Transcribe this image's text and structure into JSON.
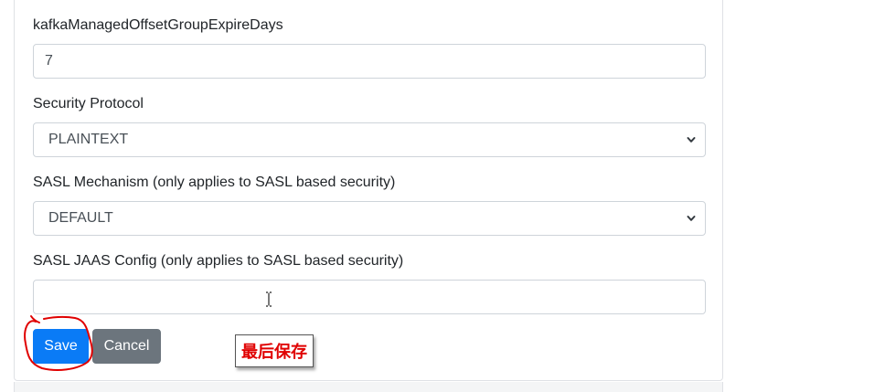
{
  "form": {
    "expire_days": {
      "label": "kafkaManagedOffsetGroupExpireDays",
      "value": "7"
    },
    "security_protocol": {
      "label": "Security Protocol",
      "selected": "PLAINTEXT"
    },
    "sasl_mechanism": {
      "label": "SASL Mechanism (only applies to SASL based security)",
      "selected": "DEFAULT"
    },
    "sasl_jaas_config": {
      "label": "SASL JAAS Config (only applies to SASL based security)",
      "value": ""
    }
  },
  "buttons": {
    "save": "Save",
    "cancel": "Cancel"
  },
  "annotation": {
    "note": "最后保存",
    "note_color": "#e00000",
    "circle_color": "#e00000"
  },
  "colors": {
    "primary": "#0a7bf6",
    "secondary": "#6c757d"
  },
  "icons": {
    "select_arrow": "chevron-down-icon",
    "text_cursor": "text-cursor-icon"
  }
}
